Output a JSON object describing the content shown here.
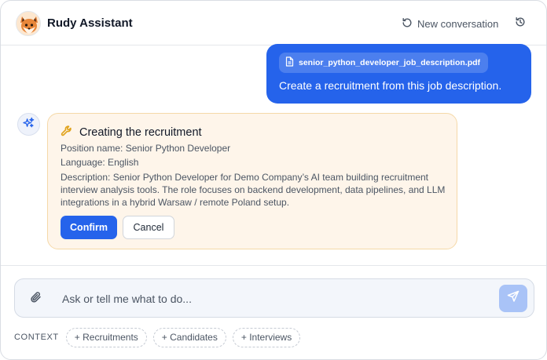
{
  "header": {
    "title": "Rudy Assistant",
    "new_conversation_label": "New conversation"
  },
  "user_message": {
    "attachment_name": "senior_python_developer_job_description.pdf",
    "text": "Create a recruitment from this job description."
  },
  "action_card": {
    "title": "Creating the recruitment",
    "position_name": "Position name: Senior Python Developer",
    "language": "Language: English",
    "description": "Description: Senior Python Developer for Demo Company’s AI team building recruitment interview analysis tools. The role focuses on backend development, data pipelines, and LLM integrations in a hybrid Warsaw / remote Poland setup.",
    "confirm_label": "Confirm",
    "cancel_label": "Cancel"
  },
  "composer": {
    "placeholder": "Ask or tell me what to do..."
  },
  "context": {
    "label": "CONTEXT",
    "chips": [
      "+ Recruitments",
      "+ Candidates",
      "+ Interviews"
    ]
  },
  "colors": {
    "accent": "#2563eb",
    "card_bg": "#fef5ea",
    "card_border": "#f5d9a8",
    "send_disabled": "#a9c3f7"
  },
  "icons": {
    "avatar": "fox-avatar-icon",
    "new_conversation": "refresh-icon",
    "history": "history-icon",
    "attachment": "file-icon",
    "assistant": "sparkles-icon",
    "card": "wrench-icon",
    "composer_attach": "paperclip-icon",
    "send": "send-icon"
  }
}
